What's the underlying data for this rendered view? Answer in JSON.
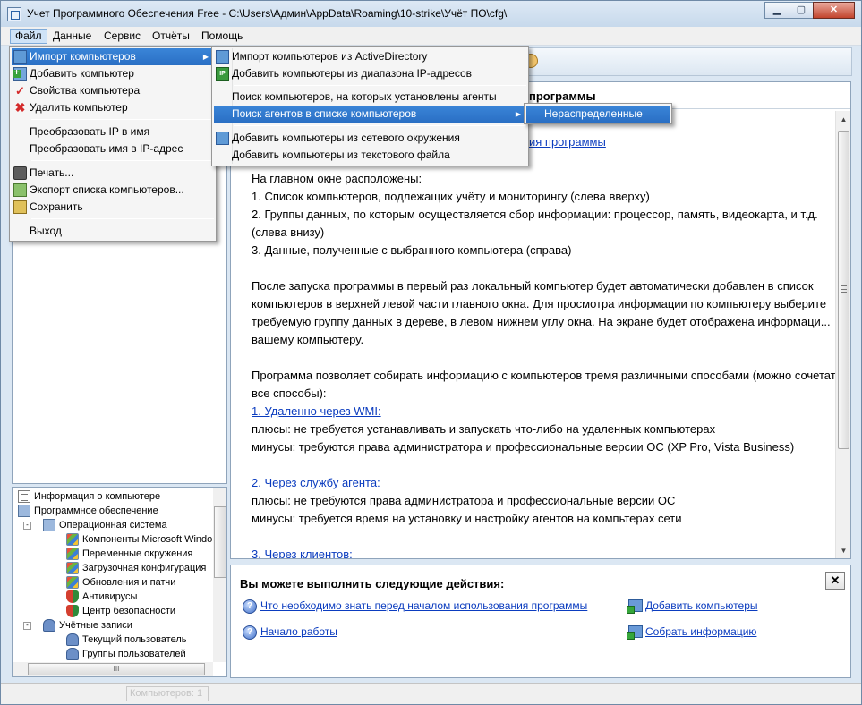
{
  "window": {
    "title": "Учет Программного Обеспечения Free - C:\\Users\\Админ\\AppData\\Roaming\\10-strike\\Учёт ПО\\cfg\\",
    "buttons": {
      "minimize": "▁",
      "maximize": "▢",
      "close": "✕"
    }
  },
  "menubar": {
    "items": [
      "Файл",
      "Данные",
      "Сервис",
      "Отчёты",
      "Помощь"
    ],
    "active": "Файл"
  },
  "file_menu": {
    "items": [
      {
        "label": "Импорт компьютеров",
        "icon": "import-icon",
        "submenu": true,
        "highlighted": true
      },
      {
        "label": "Добавить компьютер",
        "icon": "add-computer-icon"
      },
      {
        "label": "Свойства компьютера",
        "icon": "checkmark-icon"
      },
      {
        "label": "Удалить компьютер",
        "icon": "delete-icon"
      },
      {
        "label": "Преобразовать IP в имя"
      },
      {
        "label": "Преобразовать имя в IP-адрес"
      },
      {
        "label": "Печать...",
        "icon": "print-icon"
      },
      {
        "label": "Экспорт списка компьютеров...",
        "icon": "export-icon"
      },
      {
        "label": "Сохранить",
        "icon": "save-icon"
      },
      {
        "label": "Выход"
      }
    ]
  },
  "import_submenu": {
    "items": [
      {
        "label": "Импорт компьютеров из ActiveDirectory",
        "icon": "active-directory-icon"
      },
      {
        "label": "Добавить компьютеры из диапазона IP-адресов",
        "icon": "ip-range-icon"
      },
      {
        "label": "Поиск компьютеров, на которых установлены агенты"
      },
      {
        "label": "Поиск агентов в списке компьютеров",
        "submenu": true,
        "highlighted": true
      },
      {
        "label": "Добавить компьютеры из сетевого окружения",
        "icon": "network-icon"
      },
      {
        "label": "Добавить компьютеры из текстового файла"
      }
    ]
  },
  "agents_submenu": {
    "items": [
      {
        "label": "Нераспределенные",
        "highlighted": true
      }
    ]
  },
  "right_panel": {
    "header": "программы",
    "top_link": "ия программы",
    "lines": [
      {
        "text": "На главном окне расположены:",
        "link": false
      },
      {
        "text": "1. Список компьютеров, подлежащих учёту и мониторингу (слева вверху)",
        "link": false
      },
      {
        "text": "2. Группы данных, по которым осуществляется сбор информации: процессор, память, видеокарта, и т.д.",
        "link": false
      },
      {
        "text": " (слева внизу)",
        "link": false
      },
      {
        "text": "3. Данные, полученные с выбранного компьютера (справа)",
        "link": false
      },
      {
        "text": "После запуска программы в первый раз локальный компьютер будет автоматически добавлен в список",
        "link": false
      },
      {
        "text": " компьютеров в верхней левой части главного окна. Для просмотра информации по компьютеру выберите",
        "link": false
      },
      {
        "text": " требуемую группу данных в дереве, в левом нижнем углу окна. На экране будет отображена информаци...",
        "link": false
      },
      {
        "text": " вашему компьютеру.",
        "link": false
      },
      {
        "text": "Программа позволяет собирать информацию с компьютеров тремя различными способами (можно сочетать",
        "link": false
      },
      {
        "text": " все способы):",
        "link": false
      },
      {
        "text": "1. Удаленно через WMI: ",
        "link": true
      },
      {
        "text": "плюсы: не требуется устанавливать и запускать что-либо на удаленных компьютерах",
        "link": false
      },
      {
        "text": "минусы: требуются права администратора и профессиональные версии ОС (XP Pro, Vista Business)",
        "link": false
      },
      {
        "text": "2. Через службу агента: ",
        "link": true
      },
      {
        "text": "плюсы: не требуются права администратора и профессиональные версии ОС",
        "link": false
      },
      {
        "text": "минусы: требуется время на установку и настройку агентов на компьтерах сети",
        "link": false
      },
      {
        "text": "3. Через клиентов: ",
        "link": true
      }
    ]
  },
  "actions_panel": {
    "title": "Вы можете выполнить следующие действия:",
    "close_label": "✕",
    "links": {
      "what_to_know": "Что необходимо знать перед началом использования программы ",
      "getting_started": "Начало работы",
      "add_computers": "Добавить компьютеры",
      "collect_info": "Собрать информацию"
    }
  },
  "tree": {
    "nodes": [
      {
        "label": "Информация о компьютере",
        "icon": "document-icon",
        "level": 0
      },
      {
        "label": "Программное обеспечение",
        "icon": "software-icon",
        "level": 0
      },
      {
        "label": "Операционная система",
        "icon": "os-icon",
        "level": 1
      },
      {
        "label": "Компоненты Microsoft Windo",
        "icon": "windows-icon",
        "level": 2
      },
      {
        "label": "Переменные окружения",
        "icon": "windows-icon",
        "level": 2
      },
      {
        "label": "Загрузочная конфигурация",
        "icon": "windows-icon",
        "level": 2
      },
      {
        "label": "Обновления и патчи",
        "icon": "windows-icon",
        "level": 2
      },
      {
        "label": "Антивирусы",
        "icon": "shield-icon",
        "level": 2
      },
      {
        "label": "Центр безопасности",
        "icon": "shield-icon",
        "level": 2
      },
      {
        "label": "Учётные записи",
        "icon": "users-icon",
        "level": 1
      },
      {
        "label": "Текущий пользователь",
        "icon": "user-icon",
        "level": 2
      },
      {
        "label": "Группы пользователей",
        "icon": "users-icon",
        "level": 2
      }
    ],
    "hscroll_grip": "III"
  },
  "statusbar": {
    "computers": "Компьютеров: 1"
  }
}
